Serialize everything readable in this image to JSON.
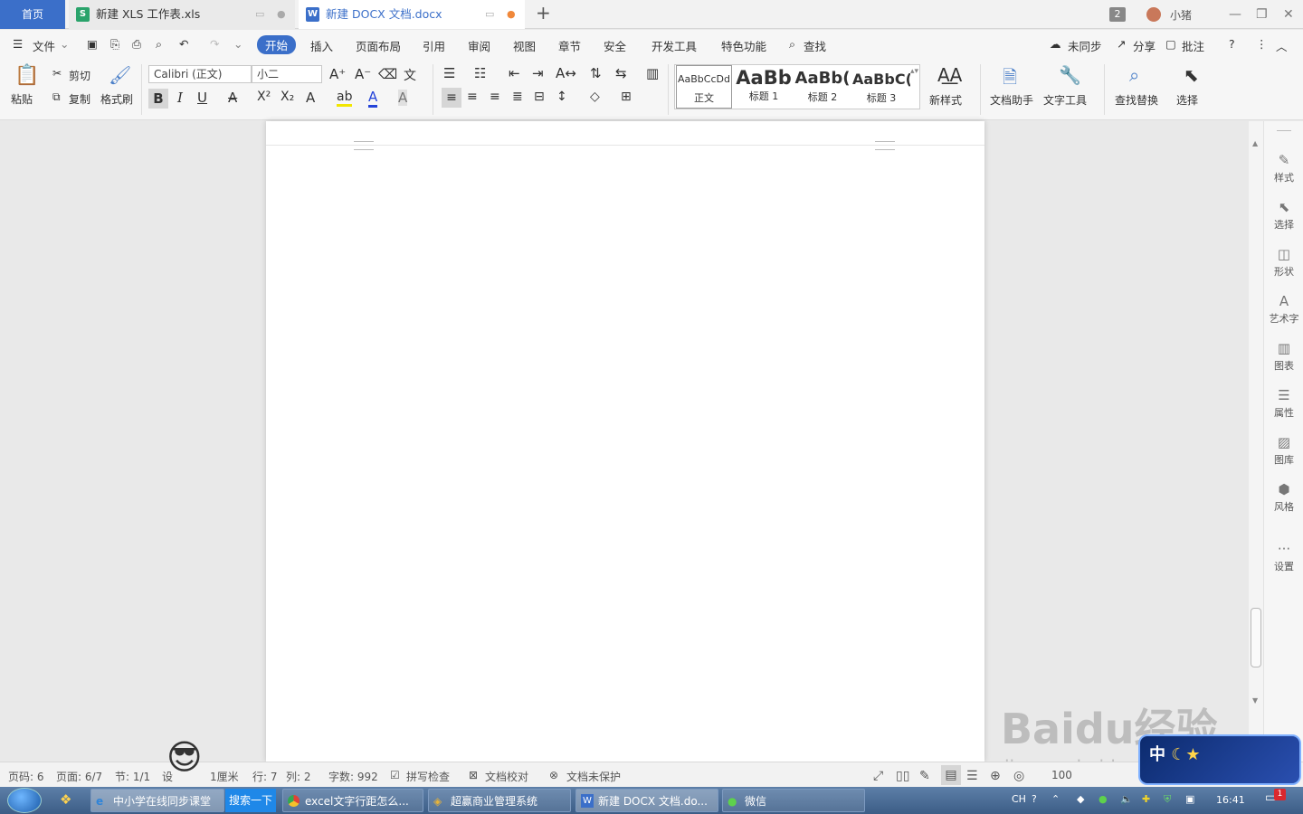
{
  "tabs": {
    "home": "首页",
    "xls": "新建 XLS 工作表.xls",
    "docx": "新建 DOCX 文档.docx",
    "notify_count": "2",
    "user": "小猪"
  },
  "menu": {
    "file": "文件",
    "items": [
      "开始",
      "插入",
      "页面布局",
      "引用",
      "审阅",
      "视图",
      "章节",
      "安全",
      "开发工具",
      "特色功能"
    ],
    "find": "查找",
    "sync": "未同步",
    "share": "分享",
    "comment": "批注"
  },
  "ribbon": {
    "paste": "粘贴",
    "cut": "剪切",
    "copy": "复制",
    "format_painter": "格式刷",
    "font": "Calibri (正文)",
    "size": "小二",
    "styles": [
      {
        "preview": "AaBbCcDd",
        "label": "正文"
      },
      {
        "preview": "AaBb",
        "label": "标题 1"
      },
      {
        "preview": "AaBb(",
        "label": "标题 2"
      },
      {
        "preview": "AaBbC(",
        "label": "标题 3"
      }
    ],
    "new_style": "新样式",
    "doc_helper": "文档助手",
    "text_tools": "文字工具",
    "find_replace": "查找替换",
    "select": "选择"
  },
  "sidebar": [
    "样式",
    "选择",
    "形状",
    "艺术字",
    "图表",
    "属性",
    "图库",
    "风格",
    "设置"
  ],
  "status": {
    "page_num": "页码: 6",
    "pages": "页面: 6/7",
    "section": "节: 1/1",
    "setting": "设",
    "cm": "1厘米",
    "row": "行: 7",
    "col": "列: 2",
    "words": "字数: 992",
    "spell": "拼写检查",
    "proof": "文档校对",
    "protect": "文档未保护",
    "zoom": "100"
  },
  "taskbar": {
    "items": [
      "中小学在线同步课堂",
      "excel文字行距怎么...",
      "超赢商业管理系统",
      "新建 DOCX 文档.do...",
      "微信"
    ],
    "search": "搜索一下",
    "lang": "CH",
    "time": "16:41",
    "badge": "1"
  },
  "watermark": {
    "brand": "Baidu经验",
    "url": "jingyan.baidu.com"
  }
}
